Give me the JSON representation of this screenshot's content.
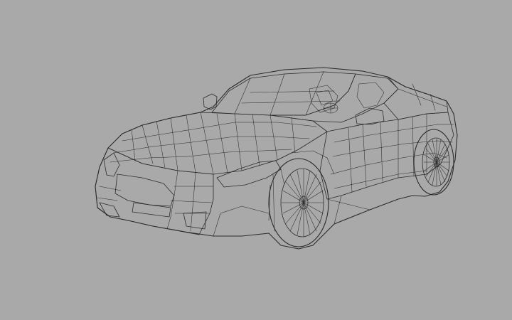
{
  "viewport": {
    "background_color": "#a9a9a9"
  },
  "model": {
    "subject": "sports-car-convertible",
    "render_style": "wireframe",
    "surface_color": "#e4e8e6",
    "wire_color": "#2b2b2b",
    "glass_color": "#d4dad8",
    "tire_color": "#cfd4d2"
  }
}
